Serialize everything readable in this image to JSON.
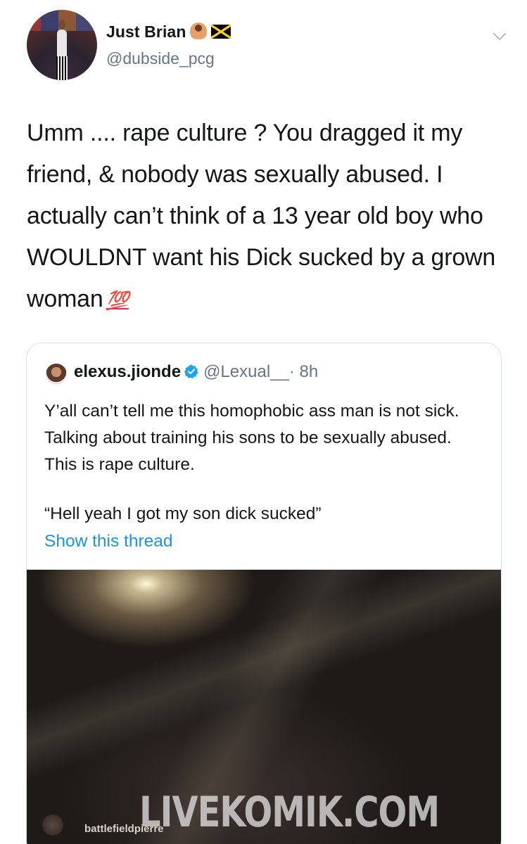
{
  "tweet": {
    "author": {
      "display_name": "Just Brian",
      "emojis": [
        "person-shrugging-emoji",
        "jamaica-flag-emoji"
      ],
      "username": "@dubside_pcg"
    },
    "text": "Umm .... rape culture ? You dragged it my friend, & nobody was sexually abused. I actually can’t think of a 13 year old boy who WOULDNT want his Dick sucked by a grown woman",
    "trailing_emoji": "💯"
  },
  "quoted_tweet": {
    "display_name": "elexus.jionde",
    "verified": true,
    "username": "@Lexual__",
    "time": "· 8h",
    "paragraph_1": "Y’all can’t tell me this homophobic ass man is not sick. Talking about training his sons to be sexually abused. This is rape culture.",
    "paragraph_2": "“Hell yeah I got my son dick sucked”",
    "show_thread": "Show this thread",
    "media": {
      "watermark": "LIVEKOMIK.COM",
      "streamer_name": "battlefieldpierre"
    }
  },
  "colors": {
    "text": "#14171a",
    "secondary_text": "#657786",
    "link": "#1b95e0",
    "verified": "#1da1f2",
    "border": "#d9dfe4"
  },
  "icons": {
    "menu": "chevron-down-icon",
    "verified": "verified-badge-icon"
  }
}
